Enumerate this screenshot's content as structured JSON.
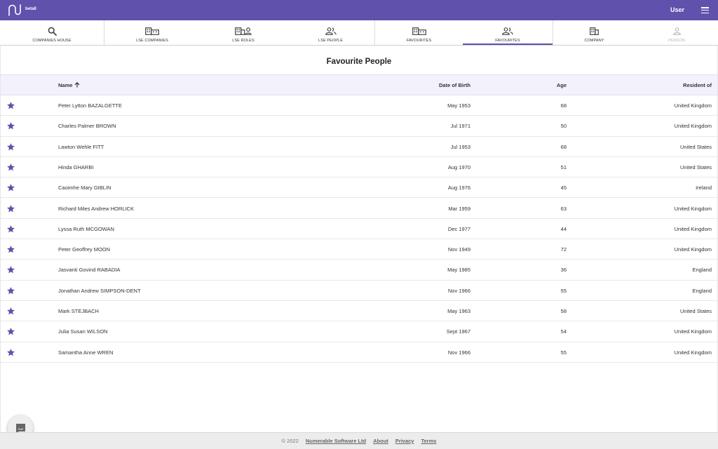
{
  "header": {
    "beta": "beta8",
    "user": "User",
    "accent_color": "#6051ad"
  },
  "nav": {
    "tabs": [
      {
        "label": "COMPANIES HOUSE",
        "icon": "search-icon"
      },
      {
        "label": "LSE COMPANIES",
        "icon": "buildings-icon"
      },
      {
        "label": "LSE ROLES",
        "icon": "building-person-icon"
      },
      {
        "label": "LSE PEOPLE",
        "icon": "people-icon"
      },
      {
        "label": "FAVOURITES",
        "icon": "buildings-icon"
      },
      {
        "label": "FAVOURITES",
        "icon": "people-icon",
        "active": true
      },
      {
        "label": "COMPANY",
        "icon": "building-icon"
      },
      {
        "label": "PERSON",
        "icon": "person-icon",
        "disabled": true
      }
    ]
  },
  "page": {
    "title": "Favourite People"
  },
  "table": {
    "headers": {
      "name": "Name",
      "dob": "Date of Birth",
      "age": "Age",
      "resident": "Resident of"
    },
    "rows": [
      {
        "name": "Peter Lytton BAZALGETTE",
        "dob": "May 1953",
        "age": "68",
        "resident": "United Kingdom"
      },
      {
        "name": "Charles Palmer BROWN",
        "dob": "Jul 1971",
        "age": "50",
        "resident": "United Kingdom"
      },
      {
        "name": "Lawton Wehle FITT",
        "dob": "Jul 1953",
        "age": "68",
        "resident": "United States"
      },
      {
        "name": "Hinda GHARBI",
        "dob": "Aug 1970",
        "age": "51",
        "resident": "United States"
      },
      {
        "name": "Caoimhe Mary GIBLIN",
        "dob": "Aug 1976",
        "age": "45",
        "resident": "Ireland"
      },
      {
        "name": "Richard Miles Andrew HORLICK",
        "dob": "Mar 1959",
        "age": "63",
        "resident": "United Kingdom"
      },
      {
        "name": "Lyssa Ruth MCGOWAN",
        "dob": "Dec 1977",
        "age": "44",
        "resident": "United Kingdom"
      },
      {
        "name": "Peter Geoffrey MOON",
        "dob": "Nov 1949",
        "age": "72",
        "resident": "United Kingdom"
      },
      {
        "name": "Jasvanti Govind RABADIA",
        "dob": "May 1985",
        "age": "36",
        "resident": "England"
      },
      {
        "name": "Jonathan Andrew SIMPSON-DENT",
        "dob": "Nov 1966",
        "age": "55",
        "resident": "England"
      },
      {
        "name": "Mark STEJBACH",
        "dob": "May 1963",
        "age": "58",
        "resident": "United States"
      },
      {
        "name": "Julia Susan WILSON",
        "dob": "Sept 1967",
        "age": "54",
        "resident": "United Kingdom"
      },
      {
        "name": "Samantha Anne WREN",
        "dob": "Nov 1966",
        "age": "55",
        "resident": "United Kingdom"
      }
    ]
  },
  "footer": {
    "copyright": "© 2022",
    "company": "Numerable Software Ltd",
    "about": "About",
    "privacy": "Privacy",
    "terms": "Terms"
  }
}
